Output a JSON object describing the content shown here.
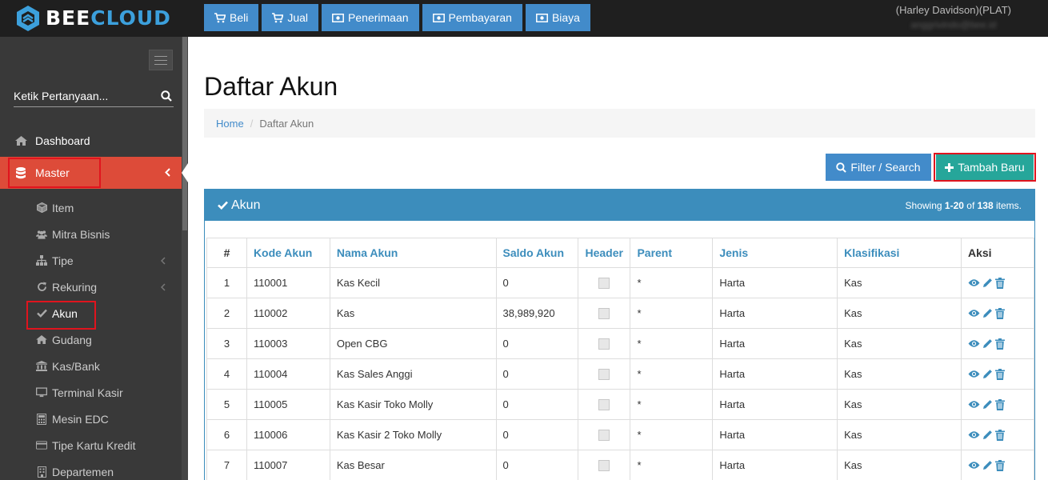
{
  "brand": {
    "name_part1": "BEE",
    "name_part2": "CLOUD"
  },
  "topnav": [
    {
      "label": "Beli",
      "icon": "cart-icon"
    },
    {
      "label": "Jual",
      "icon": "cart-icon"
    },
    {
      "label": "Penerimaan",
      "icon": "money-icon"
    },
    {
      "label": "Pembayaran",
      "icon": "money-icon"
    },
    {
      "label": "Biaya",
      "icon": "money-icon"
    }
  ],
  "user": {
    "company": "(Harley Davidson)(PLAT)",
    "email": "anggrivindo@bee.id"
  },
  "sidebar": {
    "search_placeholder": "Ketik Pertanyaan...",
    "dashboard": "Dashboard",
    "master": "Master",
    "sub_items": [
      {
        "label": "Item",
        "icon": "cube-icon"
      },
      {
        "label": "Mitra Bisnis",
        "icon": "users-icon"
      },
      {
        "label": "Tipe",
        "icon": "sitemap-icon"
      },
      {
        "label": "Rekuring",
        "icon": "refresh-icon"
      },
      {
        "label": "Akun",
        "icon": "check-icon"
      },
      {
        "label": "Gudang",
        "icon": "home-icon"
      },
      {
        "label": "Kas/Bank",
        "icon": "bank-icon"
      },
      {
        "label": "Terminal Kasir",
        "icon": "monitor-icon"
      },
      {
        "label": "Mesin EDC",
        "icon": "calculator-icon"
      },
      {
        "label": "Tipe Kartu Kredit",
        "icon": "credit-card-icon"
      },
      {
        "label": "Departemen",
        "icon": "building-icon"
      }
    ]
  },
  "page": {
    "title": "Daftar Akun",
    "breadcrumb_home": "Home",
    "breadcrumb_current": "Daftar Akun",
    "filter_label": "Filter / Search",
    "add_label": "Tambah Baru"
  },
  "panel": {
    "title": "Akun",
    "summary_prefix": "Showing ",
    "summary_range": "1-20",
    "summary_mid": " of ",
    "summary_total": "138",
    "summary_suffix": " items."
  },
  "table": {
    "columns": [
      "#",
      "Kode Akun",
      "Nama Akun",
      "Saldo Akun",
      "Header",
      "Parent",
      "Jenis",
      "Klasifikasi",
      "Aksi"
    ],
    "rows": [
      {
        "no": "1",
        "kode": "110001",
        "nama": "Kas Kecil",
        "saldo": "0",
        "parent": "*",
        "jenis": "Harta",
        "klasifikasi": "Kas"
      },
      {
        "no": "2",
        "kode": "110002",
        "nama": "Kas",
        "saldo": "38,989,920",
        "parent": "*",
        "jenis": "Harta",
        "klasifikasi": "Kas"
      },
      {
        "no": "3",
        "kode": "110003",
        "nama": "Open CBG",
        "saldo": "0",
        "parent": "*",
        "jenis": "Harta",
        "klasifikasi": "Kas"
      },
      {
        "no": "4",
        "kode": "110004",
        "nama": "Kas Sales Anggi",
        "saldo": "0",
        "parent": "*",
        "jenis": "Harta",
        "klasifikasi": "Kas"
      },
      {
        "no": "5",
        "kode": "110005",
        "nama": "Kas Kasir Toko Molly",
        "saldo": "0",
        "parent": "*",
        "jenis": "Harta",
        "klasifikasi": "Kas"
      },
      {
        "no": "6",
        "kode": "110006",
        "nama": "Kas Kasir 2 Toko Molly",
        "saldo": "0",
        "parent": "*",
        "jenis": "Harta",
        "klasifikasi": "Kas"
      },
      {
        "no": "7",
        "kode": "110007",
        "nama": "Kas Besar",
        "saldo": "0",
        "parent": "*",
        "jenis": "Harta",
        "klasifikasi": "Kas"
      }
    ]
  },
  "colors": {
    "accent": "#428bca",
    "active": "#dd4b39",
    "add": "#26a69a",
    "highlight": "#e0141e"
  }
}
